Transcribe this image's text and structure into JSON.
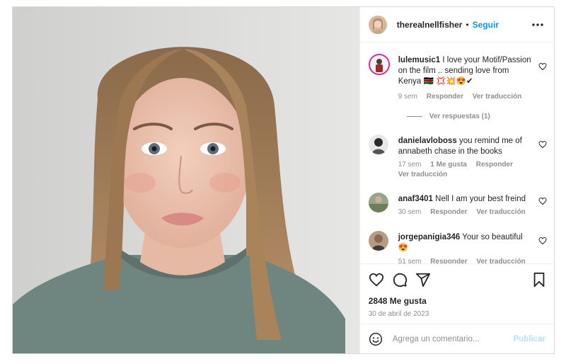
{
  "post": {
    "username": "therealnellfisher",
    "separator": "•",
    "follow_label": "Seguir",
    "likes_text": "2848 Me gusta",
    "date_text": "30 de abril de 2023"
  },
  "comments": [
    {
      "username": "lulemusic1",
      "text": "I love your Motif/Passion on the film .. sending love from Kenya",
      "trailing": "🇰🇪 💢💥😍✔",
      "time": "9 sem",
      "reply_label": "Responder",
      "translate_label": "Ver traducción",
      "view_replies_label": "Ver respuestas (1)"
    },
    {
      "username": "danielavloboss",
      "text": "you remind me of annabeth chase in the books",
      "time": "17 sem",
      "likes_label": "1 Me gusta",
      "reply_label": "Responder",
      "translate_label": "Ver traducción"
    },
    {
      "username": "anaf3401",
      "text": "Nell I am your best freind",
      "time": "30 sem",
      "reply_label": "Responder",
      "translate_label": "Ver traducción"
    },
    {
      "username": "jorgepanigia346",
      "text": "Your so beautiful",
      "trailing": "😍",
      "time": "51 sem",
      "reply_label": "Responder",
      "translate_label": "Ver traducción"
    }
  ],
  "composer": {
    "placeholder": "Agrega un comentario...",
    "post_label": "Publicar"
  },
  "colors": {
    "accent": "#0095f6",
    "muted": "#8e8e8e",
    "post_disabled": "#b2dffc"
  },
  "icons": [
    "more-options-icon",
    "heart-icon",
    "comment-icon",
    "share-icon",
    "bookmark-icon",
    "emoji-icon"
  ]
}
